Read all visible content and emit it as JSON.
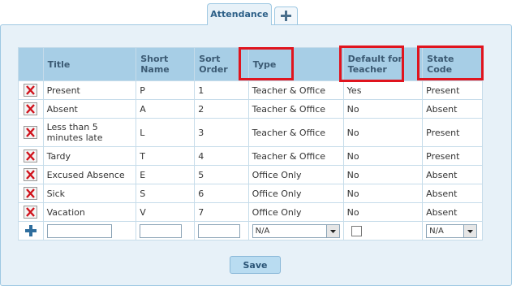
{
  "tabs": {
    "active_label": "Attendance",
    "add_icon": "plus-icon"
  },
  "columns": {
    "title": "Title",
    "short_name": "Short Name",
    "sort_order": "Sort Order",
    "type": "Type",
    "default_for_teacher": "Default for Teacher",
    "state_code": "State Code"
  },
  "rows": [
    {
      "title": "Present",
      "short": "P",
      "order": "1",
      "type": "Teacher & Office",
      "default": "Yes",
      "state": "Present"
    },
    {
      "title": "Absent",
      "short": "A",
      "order": "2",
      "type": "Teacher & Office",
      "default": "No",
      "state": "Absent"
    },
    {
      "title": "Less than 5 minutes late",
      "short": "L",
      "order": "3",
      "type": "Teacher & Office",
      "default": "No",
      "state": "Present"
    },
    {
      "title": "Tardy",
      "short": "T",
      "order": "4",
      "type": "Teacher & Office",
      "default": "No",
      "state": "Present"
    },
    {
      "title": "Excused Absence",
      "short": "E",
      "order": "5",
      "type": "Office Only",
      "default": "No",
      "state": "Absent"
    },
    {
      "title": "Sick",
      "short": "S",
      "order": "6",
      "type": "Office Only",
      "default": "No",
      "state": "Absent"
    },
    {
      "title": "Vacation",
      "short": "V",
      "order": "7",
      "type": "Office Only",
      "default": "No",
      "state": "Absent"
    }
  ],
  "new_row": {
    "title_value": "",
    "short_value": "",
    "order_value": "",
    "type_value": "N/A",
    "default_checked": false,
    "state_value": "N/A"
  },
  "save_label": "Save",
  "colors": {
    "header_bg": "#a7cee6",
    "panel_bg": "#e7f1f8",
    "highlight": "#e0141e",
    "delete_red": "#d0121b"
  }
}
